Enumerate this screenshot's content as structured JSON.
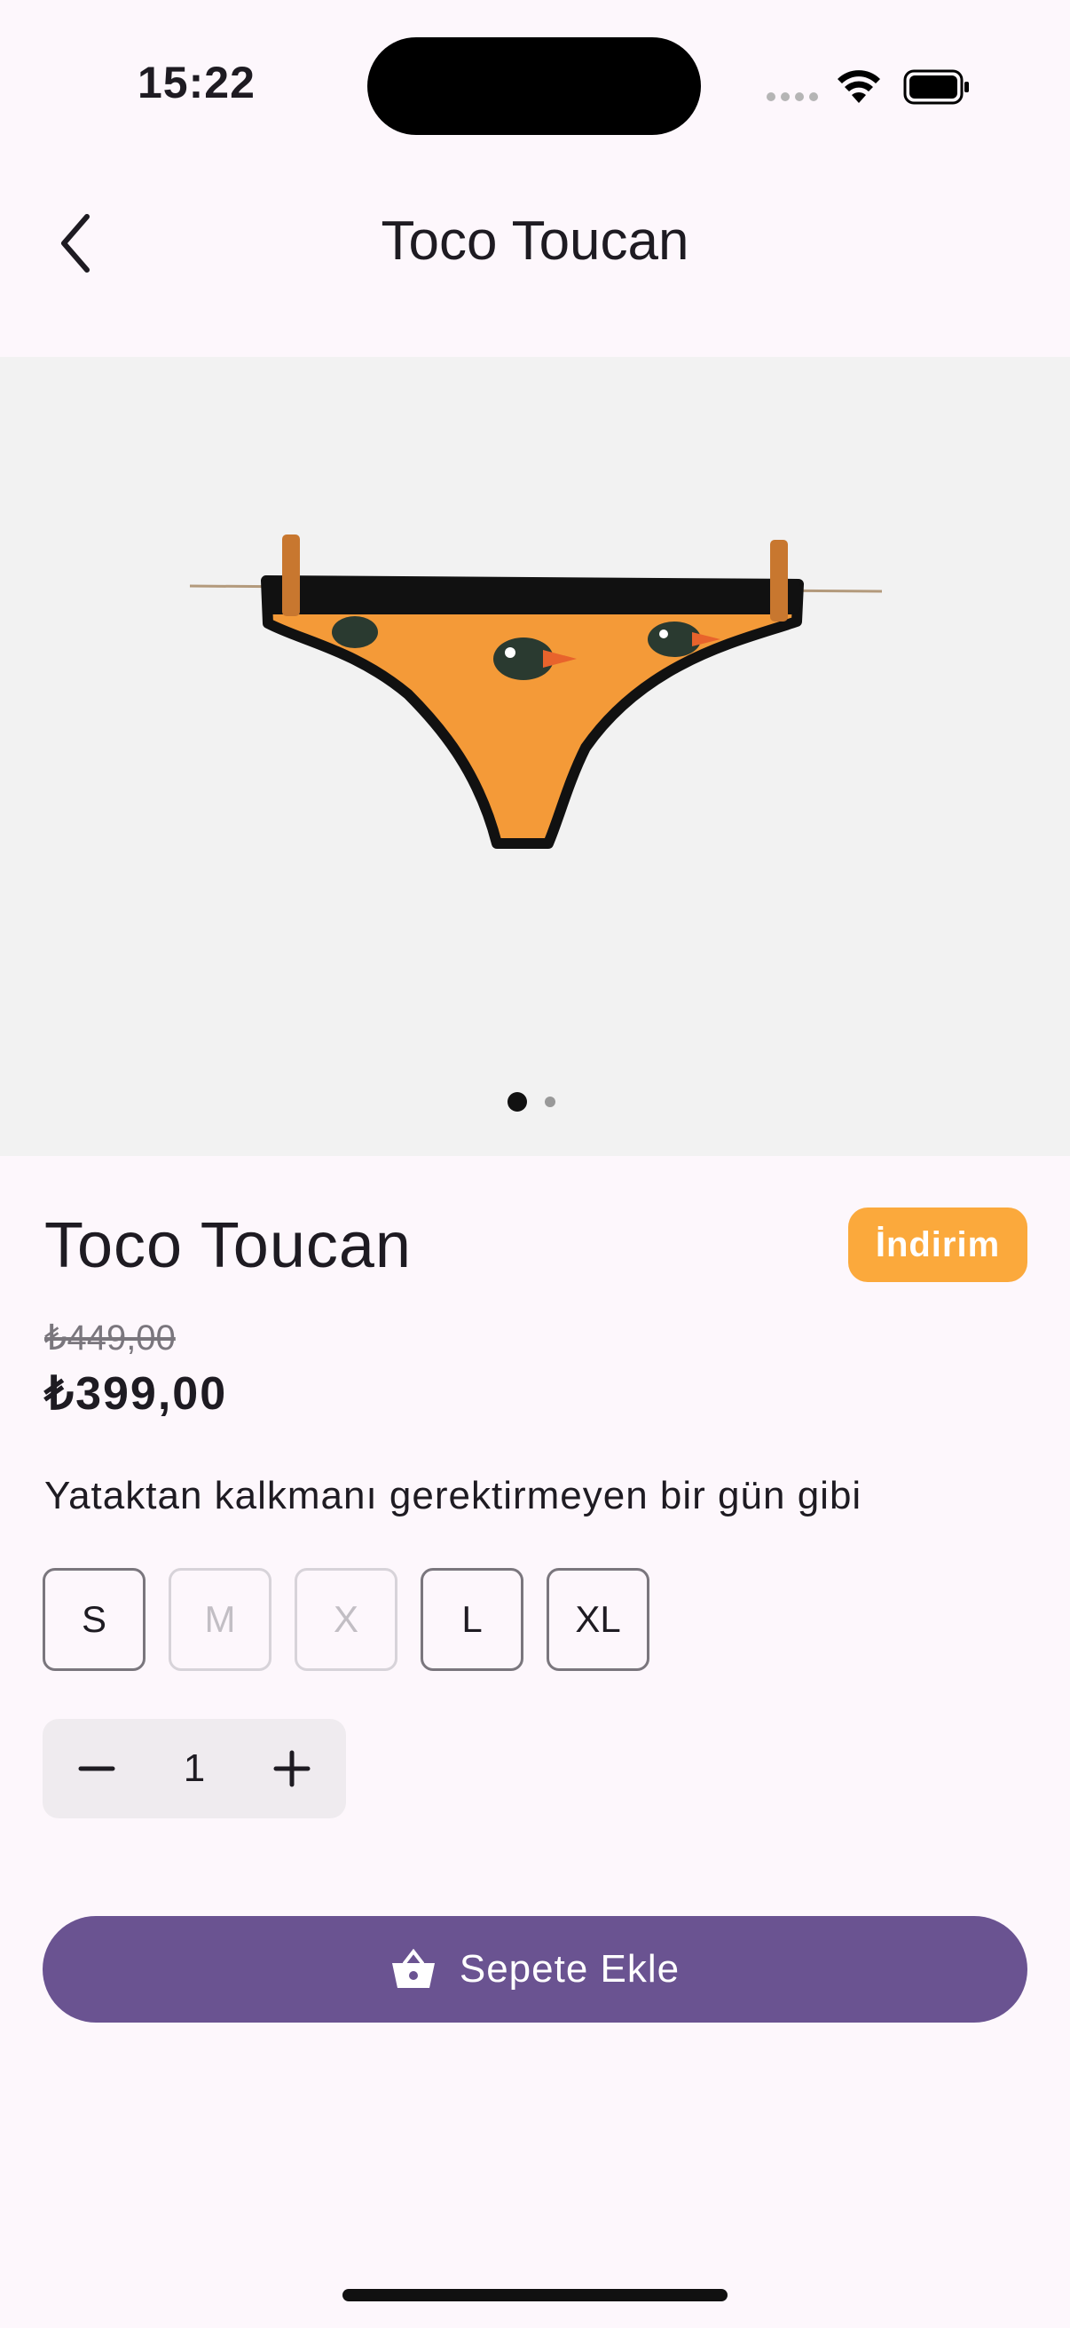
{
  "status": {
    "time": "15:22"
  },
  "header": {
    "title": "Toco Toucan"
  },
  "gallery": {
    "pages": 2,
    "active_page": 1
  },
  "product": {
    "name": "Toco Toucan",
    "badge": "İndirim",
    "old_price": "₺449,00",
    "price": "₺399,00",
    "description": "Yataktan kalkmanı gerektirmeyen bir gün gibi",
    "sizes": [
      {
        "label": "S",
        "enabled": true
      },
      {
        "label": "M",
        "enabled": false
      },
      {
        "label": "X",
        "enabled": false
      },
      {
        "label": "L",
        "enabled": true
      },
      {
        "label": "XL",
        "enabled": true
      }
    ],
    "quantity": "1"
  },
  "actions": {
    "add_to_cart": "Sepete Ekle"
  },
  "colors": {
    "accent": "#6a5391",
    "badge": "#fba93c",
    "background": "#fdf7fc"
  }
}
